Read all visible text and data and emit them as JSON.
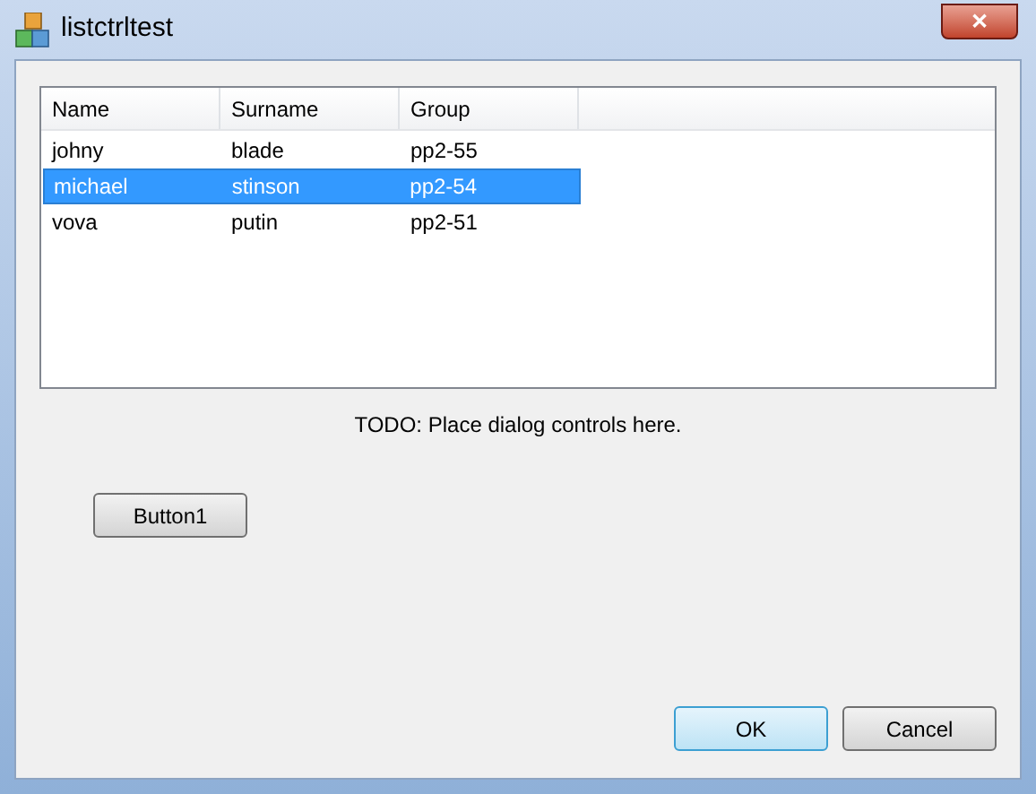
{
  "window": {
    "title": "listctrltest",
    "close_button": "✕"
  },
  "table": {
    "columns": [
      "Name",
      "Surname",
      "Group"
    ],
    "rows": [
      {
        "cells": [
          "johny",
          "blade",
          "pp2-55"
        ],
        "selected": false
      },
      {
        "cells": [
          "michael",
          "stinson",
          "pp2-54"
        ],
        "selected": true
      },
      {
        "cells": [
          "vova",
          "putin",
          "pp2-51"
        ],
        "selected": false
      }
    ]
  },
  "note": "TODO: Place dialog controls here.",
  "buttons": [
    {
      "label": "Button1",
      "default": false
    }
  ],
  "footer_buttons": [
    {
      "label": "OK",
      "default": true
    },
    {
      "label": "Cancel",
      "default": false
    }
  ]
}
